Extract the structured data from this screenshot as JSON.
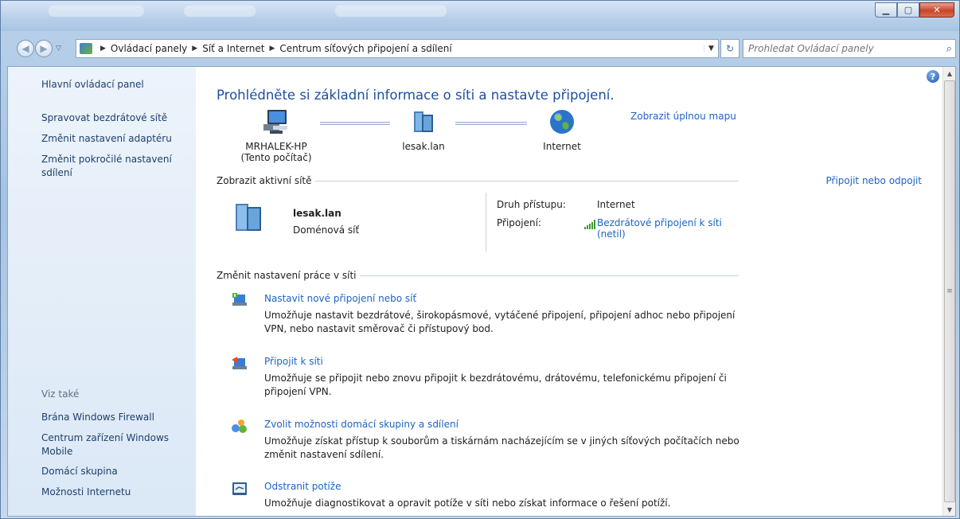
{
  "window": {
    "controls": {
      "minimize": "▁",
      "maximize": "▢",
      "close": "✕"
    }
  },
  "address": {
    "breadcrumbs": [
      "Ovládací panely",
      "Síť a Internet",
      "Centrum síťových připojení a sdílení"
    ],
    "search_placeholder": "Prohledat Ovládací panely"
  },
  "sidebar": {
    "links": [
      "Hlavní ovládací panel",
      "Spravovat bezdrátové sítě",
      "Změnit nastavení adaptéru",
      "Změnit pokročilé nastavení sdílení"
    ],
    "see_also_label": "Viz také",
    "see_also": [
      "Brána Windows Firewall",
      "Centrum zařízení Windows Mobile",
      "Domácí skupina",
      "Možnosti Internetu"
    ]
  },
  "main": {
    "heading": "Prohlédněte si základní informace o síti a nastavte připojení.",
    "full_map_link": "Zobrazit úplnou mapu",
    "map": {
      "computer": {
        "name": "MRHALEK-HP",
        "sub": "(Tento počítač)"
      },
      "network": {
        "name": "lesak.lan"
      },
      "internet": {
        "name": "Internet"
      }
    },
    "active_networks": {
      "title": "Zobrazit aktivní sítě",
      "connect_link": "Připojit nebo odpojit",
      "network_name": "lesak.lan",
      "network_type": "Doménová síť",
      "access_label": "Druh přístupu:",
      "access_value": "Internet",
      "connections_label": "Připojení:",
      "connections_value_line1": "Bezdrátové připojení k síti",
      "connections_value_line2": "(netil)"
    },
    "change_settings": {
      "title": "Změnit nastavení práce v síti",
      "tasks": [
        {
          "title": "Nastavit nové připojení nebo síť",
          "desc": "Umožňuje nastavit bezdrátové, širokopásmové, vytáčené připojení, připojení adhoc nebo připojení VPN, nebo nastavit směrovač či přístupový bod."
        },
        {
          "title": "Připojit k síti",
          "desc": "Umožňuje se připojit nebo znovu připojit k bezdrátovému, drátovému, telefonickému připojení či připojení VPN."
        },
        {
          "title": "Zvolit možnosti domácí skupiny a sdílení",
          "desc": "Umožňuje získat přístup k souborům a tiskárnám nacházejícím se v jiných síťových počítačích nebo změnit nastavení sdílení."
        },
        {
          "title": "Odstranit potíže",
          "desc": "Umožňuje diagnostikovat a opravit potíže v síti nebo získat informace o řešení potíží."
        }
      ]
    }
  },
  "colors": {
    "link": "#1c64c3",
    "heading": "#1e4fa0",
    "sidebar_link": "#1e3f6c"
  }
}
